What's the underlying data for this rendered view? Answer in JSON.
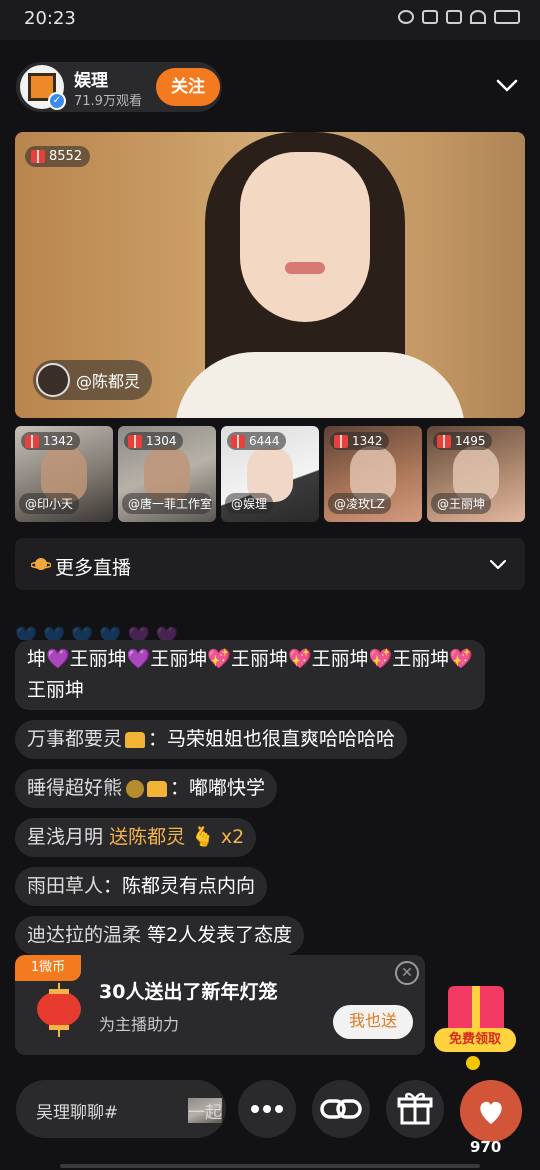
{
  "status": {
    "time": "20:23"
  },
  "header": {
    "host_name": "娱理",
    "viewers": "71.9万观看",
    "follow_label": "关注"
  },
  "main_stream": {
    "gift_count": "8552",
    "streamer": "@陈都灵"
  },
  "co_hosts": [
    {
      "gifts": "1342",
      "name": "@印小天"
    },
    {
      "gifts": "1304",
      "name": "@唐一菲工作室"
    },
    {
      "gifts": "6444",
      "name": "@娱理"
    },
    {
      "gifts": "1342",
      "name": "@凌玫LZ"
    },
    {
      "gifts": "1495",
      "name": "@王丽坤"
    }
  ],
  "more_live": {
    "label": "更多直播"
  },
  "chat": [
    {
      "text": "坤💜王丽坤💜王丽坤💖王丽坤💖王丽坤💖王丽坤💖王丽坤"
    },
    {
      "user": "万事都要灵",
      "sep": "：",
      "text": "马荣姐姐也很直爽哈哈哈哈"
    },
    {
      "user": "睡得超好熊",
      "sep": "：",
      "text": "嘟嘟快学"
    },
    {
      "user": "星浅月明",
      "gift_text": "送陈都灵",
      "count": "x2"
    },
    {
      "user": "雨田草人",
      "sep": "：",
      "text": "陈都灵有点内向"
    },
    {
      "user": "迪达拉的温柔",
      "text": "等2人发表了态度"
    }
  ],
  "gift_card": {
    "tag": "1微币",
    "title": "30人送出了新年灯笼",
    "subtitle": "为主播助力",
    "button": "我也送"
  },
  "free_gift": {
    "label": "免费领取"
  },
  "bottom": {
    "input_text": "吴理聊聊#",
    "input_text2": "一起",
    "like_count": "970"
  },
  "colors": {
    "accent": "#f47a1f",
    "gold": "#f4b44a"
  }
}
